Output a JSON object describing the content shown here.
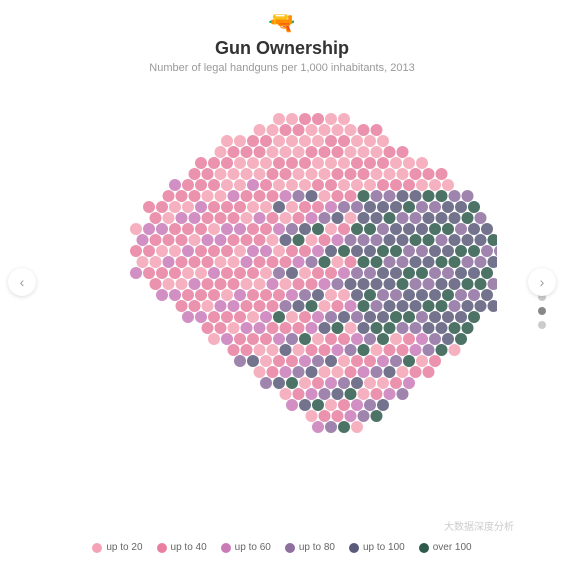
{
  "header": {
    "title": "Gun Ownership",
    "subtitle": "Number of legal handguns per 1,000 inhabitants, 2013",
    "gun_icon": "🔫"
  },
  "navigation": {
    "left_arrow": "‹",
    "right_arrow": "›"
  },
  "legend": {
    "items": [
      {
        "label": "up to 20",
        "color": "#f4a3b5"
      },
      {
        "label": "up to 40",
        "color": "#e87fa0"
      },
      {
        "label": "up to 60",
        "color": "#c97bb8"
      },
      {
        "label": "up to 80",
        "color": "#8e6fa0"
      },
      {
        "label": "up to 100",
        "color": "#5a5a7a"
      },
      {
        "label": "over 100",
        "color": "#2d5a4a"
      }
    ]
  },
  "pagination": {
    "dots": [
      false,
      false,
      true,
      false
    ]
  },
  "watermark": {
    "text": "大数据深度分析"
  }
}
